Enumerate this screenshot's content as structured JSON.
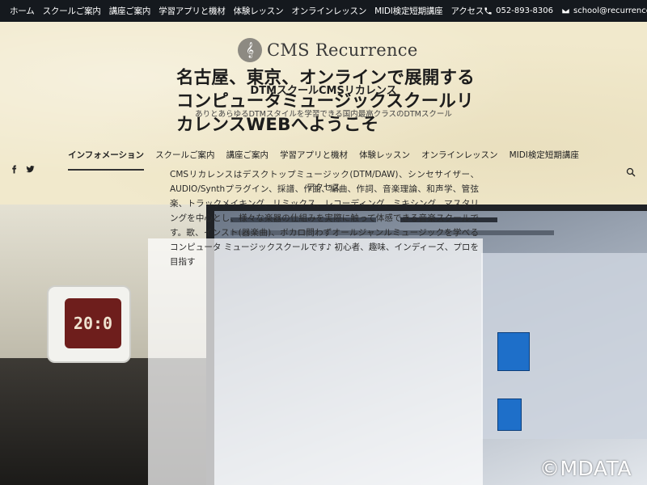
{
  "topbar": {
    "nav": [
      "ホーム",
      "スクールご案内",
      "講座ご案内",
      "学習アプリと機材",
      "体験レッスン",
      "オンラインレッスン",
      "MIDI検定短期講座",
      "アクセス"
    ],
    "phone": "052-893-8306",
    "email": "school@recurrence.net"
  },
  "header": {
    "logo_text": "CMS Recurrence",
    "site_title": "DTMスクールCMSリカレンス",
    "tagline": "ありとあらゆるDTMスタイルを学習できる国内最高クラスのDTMスクール",
    "nav": [
      {
        "label": "インフォメーション",
        "active": true
      },
      {
        "label": "スクールご案内",
        "active": false
      },
      {
        "label": "講座ご案内",
        "active": false
      },
      {
        "label": "学習アプリと機材",
        "active": false
      },
      {
        "label": "体験レッスン",
        "active": false
      },
      {
        "label": "オンラインレッスン",
        "active": false
      },
      {
        "label": "MIDI検定短期講座",
        "active": false
      }
    ],
    "nav_row2": "アクセス",
    "social_icons": [
      "facebook-icon",
      "twitter-icon"
    ],
    "search_icon": "search-icon"
  },
  "hero": {
    "title": "名古屋、東京、オンラインで展開するコンピュータミュージックスクールリカレンスWEBへようこそ",
    "body": "CMSリカレンスはデスクトップミュージック(DTM/DAW)、シンセサイザー、AUDIO/Synthプラグイン、採譜、作曲、編曲、作詞、音楽理論、和声学、管弦楽、トラックメイキング、リミックス、レコーディング、ミキシング、マスタリングを中心とし、様々な楽器の仕組みを実際に触って体感できる音楽スクールです。歌、インスト(器楽曲)、ボカロ問わずオールジャンルミュージックを学べるコンピュータ ミュージックスクールです♪ 初心者、趣味、インディーズ、プロを目指す",
    "clock_display": "20:0"
  },
  "watermark": "©MDATA",
  "colors": {
    "topbar_bg": "#15191e",
    "header_bg": "#f1e9cc",
    "text": "#222222"
  }
}
